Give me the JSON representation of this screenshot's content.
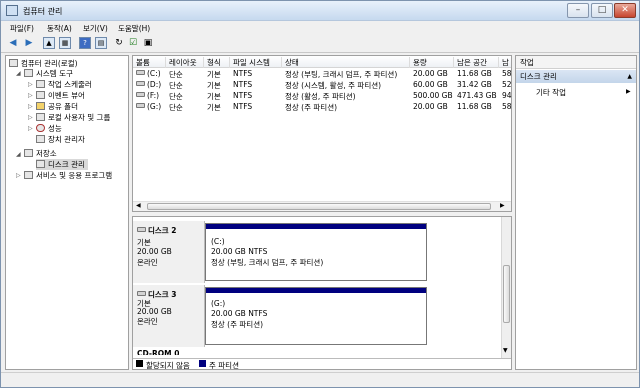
{
  "window": {
    "title": "컴퓨터 관리"
  },
  "menu": [
    "파일(F)",
    "동작(A)",
    "보기(V)",
    "도움말(H)"
  ],
  "toolbar_icons": [
    "back-arrow-icon",
    "forward-arrow-icon",
    "up-folder-icon",
    "console-tree-icon",
    "help-icon",
    "properties-icon",
    "refresh-icon",
    "check-icon",
    "export-icon"
  ],
  "tree": {
    "root": "컴퓨터 관리(로컬)",
    "system_tools": "시스템 도구",
    "task_scheduler": "작업 스케줄러",
    "event_viewer": "이벤트 뷰어",
    "shared_folders": "공유 폴더",
    "local_users": "로컬 사용자 및 그룹",
    "performance": "성능",
    "device_manager": "장치 관리자",
    "storage": "저장소",
    "disk_management": "디스크 관리",
    "services": "서비스 및 응용 프로그램"
  },
  "volume_table": {
    "columns": [
      "볼륨",
      "레이아웃",
      "형식",
      "파일 시스템",
      "상태",
      "용량",
      "남은 공간",
      "남"
    ],
    "rows": [
      {
        "volume": "(C:)",
        "layout": "단순",
        "type": "기본",
        "fs": "NTFS",
        "status": "정상 (부팅, 크래시 덤프, 주 파티션)",
        "capacity": "20.00 GB",
        "free": "11.68 GB",
        "pct": "58"
      },
      {
        "volume": "(D:)",
        "layout": "단순",
        "type": "기본",
        "fs": "NTFS",
        "status": "정상 (시스템, 활성, 주 파티션)",
        "capacity": "60.00 GB",
        "free": "31.42 GB",
        "pct": "52"
      },
      {
        "volume": "(F:)",
        "layout": "단순",
        "type": "기본",
        "fs": "NTFS",
        "status": "정상 (활성, 주 파티션)",
        "capacity": "500.00 GB",
        "free": "471.43 GB",
        "pct": "94"
      },
      {
        "volume": "(G:)",
        "layout": "단순",
        "type": "기본",
        "fs": "NTFS",
        "status": "정상 (주 파티션)",
        "capacity": "20.00 GB",
        "free": "11.68 GB",
        "pct": "58"
      }
    ]
  },
  "disks": [
    {
      "name": "디스크 2",
      "type": "기본",
      "size": "20.00 GB",
      "state": "온라인",
      "part_name": "(C:)",
      "part_size": "20.00 GB NTFS",
      "part_status": "정상 (부팅, 크래시 덤프, 주 파티션)"
    },
    {
      "name": "디스크 3",
      "type": "기본",
      "size": "20.00 GB",
      "state": "온라인",
      "part_name": "(G:)",
      "part_size": "20.00 GB NTFS",
      "part_status": "정상 (주 파티션)"
    }
  ],
  "cdrom_label": "CD-ROM 0",
  "legend": {
    "unallocated": "할당되지 않음",
    "primary": "주 파티션",
    "colors": {
      "unallocated": "#000000",
      "primary": "#00007f"
    }
  },
  "actions": {
    "header": "작업",
    "section": "디스크 관리",
    "more": "기타 작업"
  }
}
